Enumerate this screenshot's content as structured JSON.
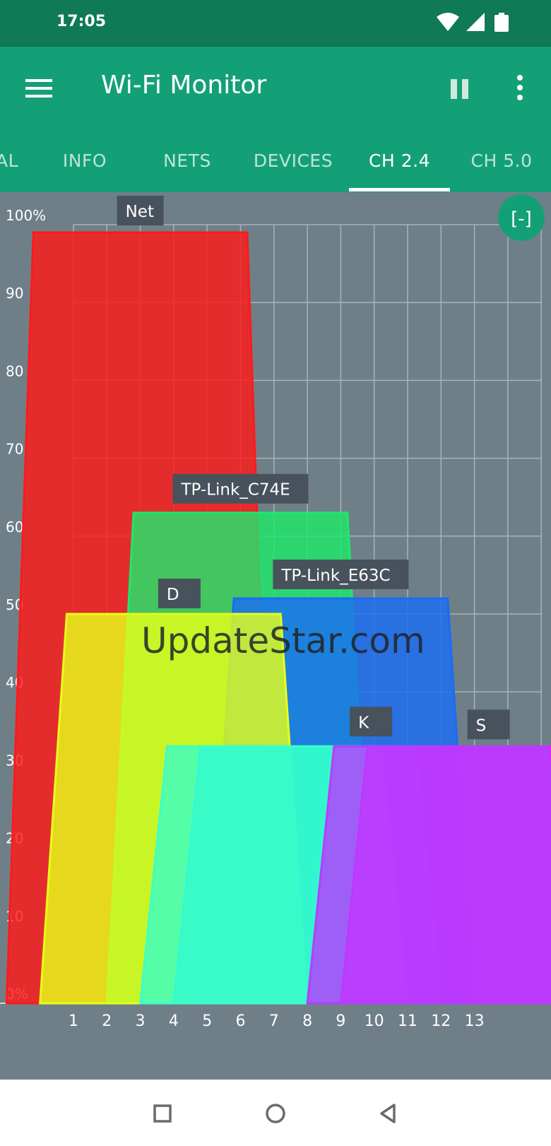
{
  "status": {
    "time": "17:05"
  },
  "app": {
    "title": "Wi-Fi Monitor",
    "icons": [
      "menu-icon",
      "pause-icon",
      "more-vert-icon"
    ]
  },
  "tabs": [
    {
      "label": "AL",
      "active": false
    },
    {
      "label": "INFO",
      "active": false
    },
    {
      "label": "NETS",
      "active": false
    },
    {
      "label": "DEVICES",
      "active": false
    },
    {
      "label": "CH 2.4",
      "active": true
    },
    {
      "label": "CH 5.0",
      "active": false
    }
  ],
  "fab": {
    "label": "[-]"
  },
  "watermark": "UpdateStar.com",
  "chart_data": {
    "type": "area",
    "x": [
      1,
      2,
      3,
      4,
      5,
      6,
      7,
      8,
      9,
      10,
      11,
      12,
      13
    ],
    "x_tick_labels": [
      "1",
      "2",
      "3",
      "4",
      "5",
      "6",
      "7",
      "8",
      "9",
      "10",
      "11",
      "12",
      "13"
    ],
    "y_tick_labels": [
      "0%",
      "10",
      "20",
      "30",
      "40",
      "50",
      "60",
      "70",
      "80",
      "90",
      "100%"
    ],
    "ylim": [
      0,
      100
    ],
    "xlim": [
      1,
      15
    ],
    "grid": true,
    "series": [
      {
        "name": "Net",
        "channel": 3,
        "signal": 99,
        "color": "#ff1a1a"
      },
      {
        "name": "TP-Link_C74E",
        "channel": 6,
        "signal": 63,
        "color": "#1ee86a"
      },
      {
        "name": "TP-Link_E63C",
        "channel": 9,
        "signal": 52,
        "color": "#1a6cf5"
      },
      {
        "name": "D",
        "channel": 4,
        "signal": 50,
        "color": "#e5ff1a"
      },
      {
        "name": "K",
        "channel": 8,
        "signal": 33,
        "color": "#00e5ff"
      },
      {
        "name": "",
        "channel": 7,
        "signal": 33,
        "color": "#3dffc4"
      },
      {
        "name": "S",
        "channel": 13,
        "signal": 33,
        "color": "#ee1aff"
      },
      {
        "name": "",
        "channel": 12,
        "signal": 33,
        "color": "#b63dff"
      }
    ]
  }
}
